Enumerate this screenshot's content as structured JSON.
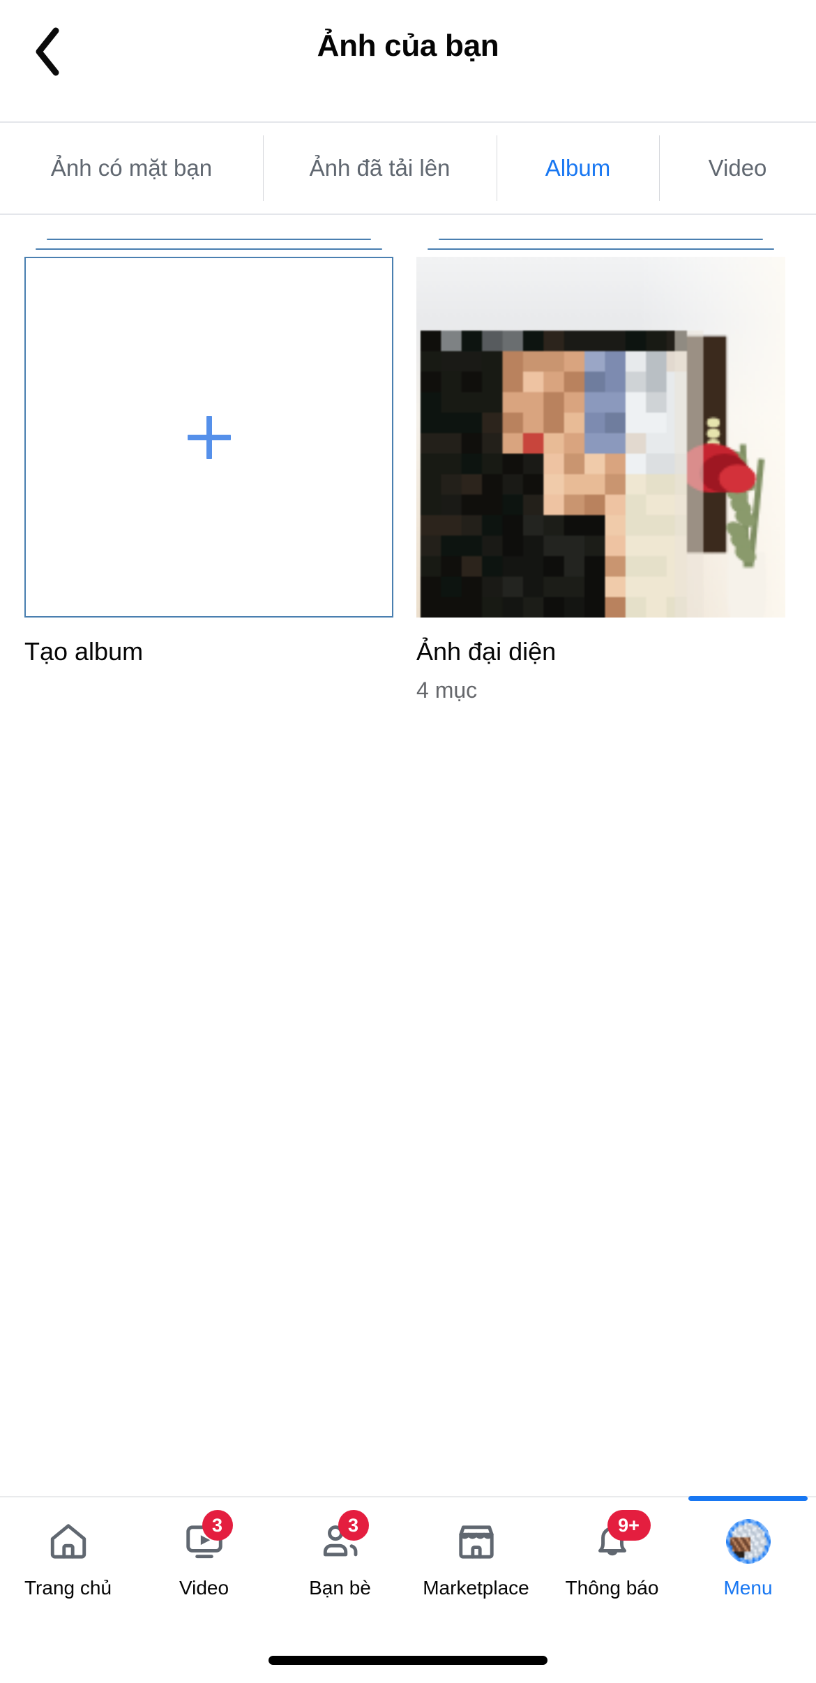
{
  "header": {
    "back_icon": "chevron-left-icon",
    "title": "Ảnh của bạn"
  },
  "tabs": [
    {
      "label": "Ảnh có mặt bạn",
      "active": false
    },
    {
      "label": "Ảnh đã tải lên",
      "active": false
    },
    {
      "label": "Album",
      "active": true
    },
    {
      "label": "Video",
      "active": false
    }
  ],
  "albums": [
    {
      "kind": "create",
      "icon": "plus-icon",
      "label": "Tạo album",
      "count": ""
    },
    {
      "kind": "photo",
      "label": "Ảnh đại diện",
      "count": "4 mục"
    }
  ],
  "bottom_nav": [
    {
      "icon": "home-icon",
      "label": "Trang chủ",
      "badge": "",
      "active": false
    },
    {
      "icon": "video-icon",
      "label": "Video",
      "badge": "3",
      "active": false
    },
    {
      "icon": "friends-icon",
      "label": "Bạn bè",
      "badge": "3",
      "active": false
    },
    {
      "icon": "marketplace-icon",
      "label": "Marketplace",
      "badge": "",
      "active": false
    },
    {
      "icon": "bell-icon",
      "label": "Thông báo",
      "badge": "9+",
      "active": false
    },
    {
      "icon": "avatar-icon",
      "label": "Menu",
      "badge": "",
      "active": true
    }
  ],
  "colors": {
    "accent": "#1877f2",
    "tab_active": "#1877f2",
    "badge": "#e41e3f",
    "text_primary": "#050505",
    "text_secondary": "#65676b",
    "divider": "#e4e6eb",
    "tile_border": "#4a7fb0",
    "plus": "#5590ea"
  }
}
